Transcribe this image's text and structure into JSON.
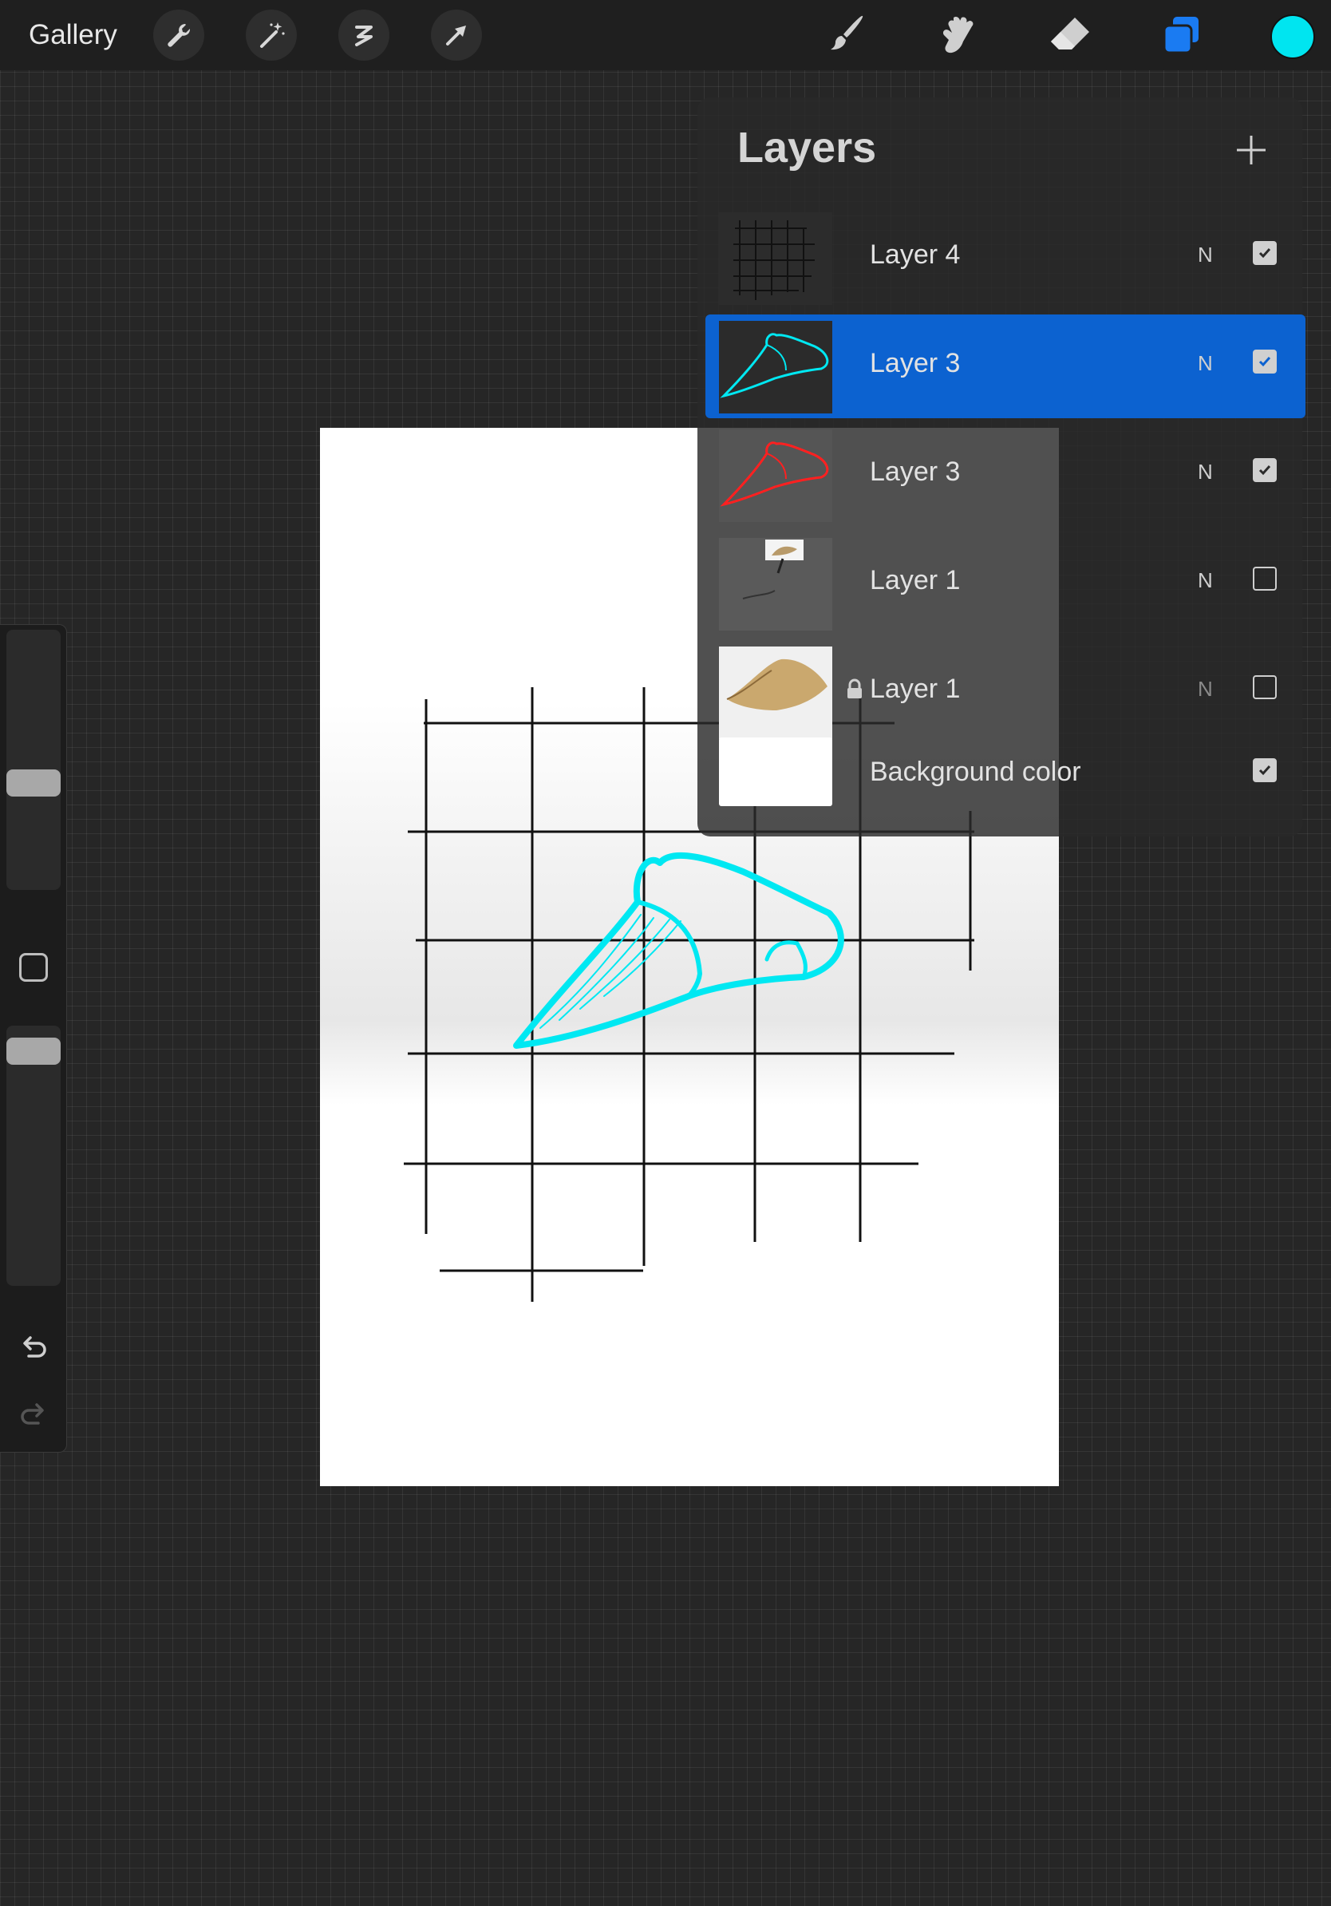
{
  "toolbar": {
    "gallery_label": "Gallery",
    "left_tools": [
      "wrench-icon",
      "magic-wand-icon",
      "selection-icon",
      "transform-arrow-icon"
    ],
    "right_tools": [
      "brush-icon",
      "smudge-icon",
      "eraser-icon",
      "layers-icon"
    ],
    "active_color": "#00e5f0",
    "layers_active_color": "#1a7bf2"
  },
  "sidebar": {
    "brush_size_level": 0.4,
    "opacity_level": 0.95,
    "icons": [
      "modify-square-icon",
      "undo-icon",
      "redo-icon"
    ]
  },
  "layers": {
    "title": "Layers",
    "add_icon": "plus-icon",
    "items": [
      {
        "name": "Layer 4",
        "blend": "N",
        "visible": true,
        "selected": false,
        "locked": false,
        "thumb": "grid"
      },
      {
        "name": "Layer 3",
        "blend": "N",
        "visible": true,
        "selected": true,
        "locked": false,
        "thumb": "cyan-tooth"
      },
      {
        "name": "Layer 3",
        "blend": "N",
        "visible": true,
        "selected": false,
        "locked": false,
        "thumb": "red-tooth"
      },
      {
        "name": "Layer 1",
        "blend": "N",
        "visible": false,
        "selected": false,
        "locked": false,
        "thumb": "reference"
      },
      {
        "name": "Layer 1",
        "blend": "N",
        "visible": false,
        "selected": false,
        "locked": true,
        "thumb": "photo"
      },
      {
        "name": "Background color",
        "blend": "",
        "visible": true,
        "selected": false,
        "locked": false,
        "thumb": "white"
      }
    ]
  },
  "colors": {
    "stroke_cyan": "#00e8f2",
    "stroke_red": "#ff2020",
    "selection_blue": "#0c62d0"
  }
}
